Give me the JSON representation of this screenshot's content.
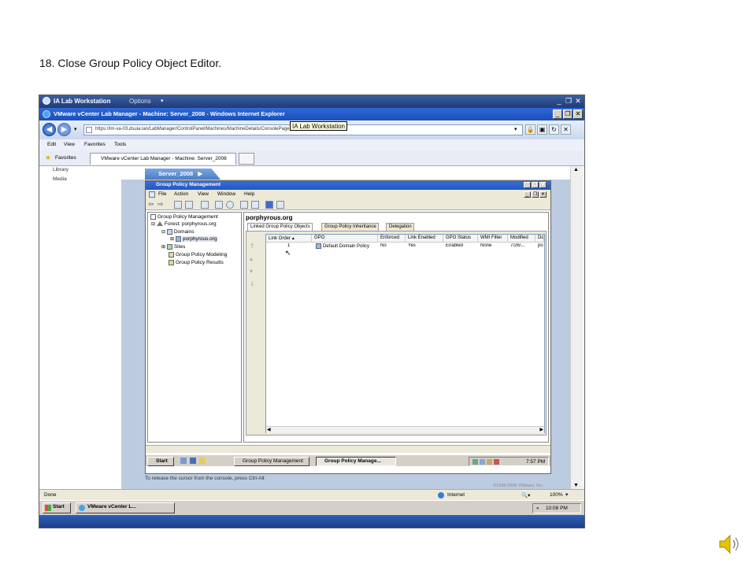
{
  "caption": "18. Close Group Policy Object Editor.",
  "ia_bar": {
    "title": "IA Lab Workstation",
    "options": "Options"
  },
  "ie": {
    "title": "VMware vCenter Lab Manager - Machine: Server_2008 - Windows Internet Explorer",
    "url": "https://lm-va-03.dsuia.lan/LabManager/ControlPanel/Machines/MachineDetails/ConsolePage.aspx?id=000",
    "tooltip": "IA Lab Workstation",
    "menu": [
      "Edit",
      "View",
      "Favorites",
      "Tools"
    ],
    "favorites_label": "Favorites",
    "tab_title": "VMware vCenter Lab Manager - Machine: Server_2008",
    "status_left": "Done",
    "status_zone": "Internet",
    "status_zoom": "100%"
  },
  "left_nav": [
    "Library",
    "Media"
  ],
  "server_tab": "Server_2008",
  "gpm": {
    "title": "Group Policy Management",
    "menu": [
      "File",
      "Action",
      "View",
      "Window",
      "Help"
    ],
    "tree": [
      {
        "label": "Group Policy Management",
        "indent": 0
      },
      {
        "label": "Forest: porphyrous.org",
        "indent": 1
      },
      {
        "label": "Domains",
        "indent": 2
      },
      {
        "label": "porphyrous.org",
        "indent": 3
      },
      {
        "label": "Sites",
        "indent": 2
      },
      {
        "label": "Group Policy Modeling",
        "indent": 2
      },
      {
        "label": "Group Policy Results",
        "indent": 2
      }
    ],
    "header": "porphyrous.org",
    "tabs": [
      "Linked Group Policy Objects",
      "Group Policy Inheritance",
      "Delegation"
    ],
    "columns": [
      "Link Order",
      "GPO",
      "Enforced",
      "Link Enabled",
      "GPO Status",
      "WMI Filter",
      "Modified",
      "Do"
    ],
    "rows": [
      [
        "1",
        "Default Domain Policy",
        "No",
        "Yes",
        "Enabled",
        "None",
        "7/26/...",
        "po"
      ]
    ]
  },
  "vm_taskbar": {
    "start": "Start",
    "buttons": [
      "Group Policy Management",
      "Group Policy Manage..."
    ],
    "time": "7:57 PM"
  },
  "console_hint": "To release the cursor from the console, press Ctrl-Alt",
  "copyright": "©1998-2008 VMware, Inc.",
  "host_taskbar": {
    "start": "Start",
    "button": "VMware vCenter L...",
    "time": "10:08 PM"
  }
}
